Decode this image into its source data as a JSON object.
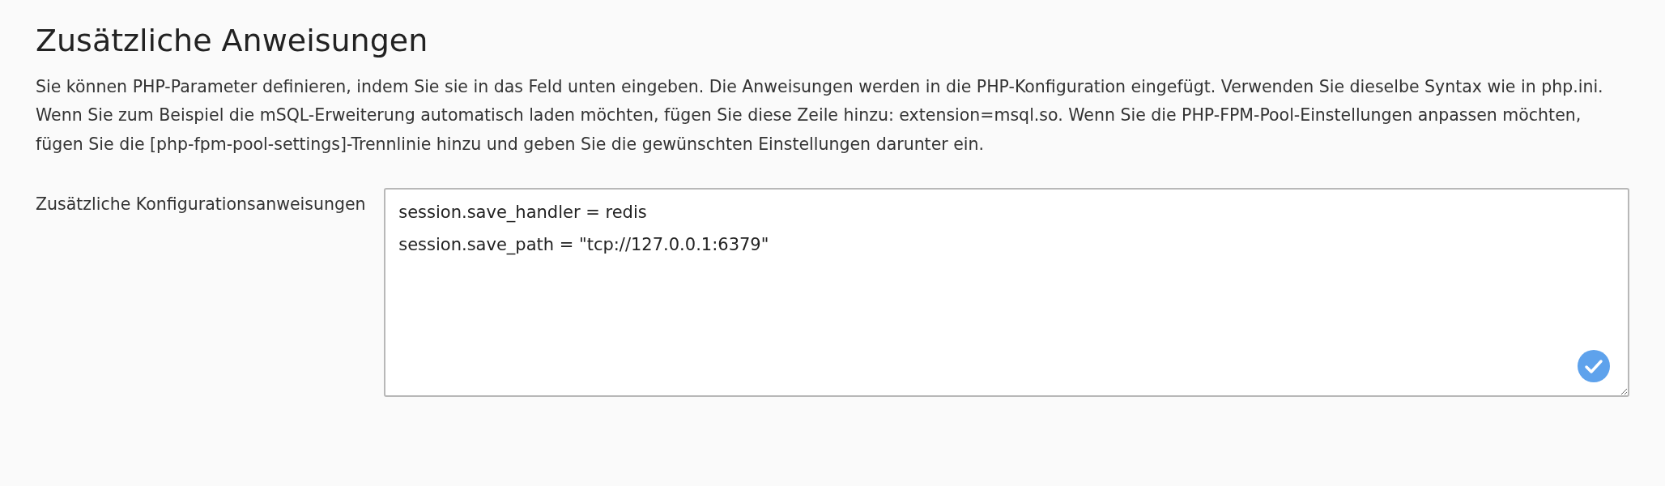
{
  "heading": "Zusätzliche Anweisungen",
  "description": "Sie können PHP-Parameter definieren, indem Sie sie in das Feld unten eingeben. Die Anweisungen werden in die PHP-Konfiguration eingefügt. Verwenden Sie dieselbe Syntax wie in php.ini. Wenn Sie zum Beispiel die mSQL-Erweiterung automatisch laden möchten, fügen Sie diese Zeile hinzu: extension=msql.so. Wenn Sie die PHP-FPM-Pool-Einstellungen anpassen möchten, fügen Sie die [php-fpm-pool-settings]-Trennlinie hinzu und geben Sie die gewünschten Einstellungen darunter ein.",
  "field": {
    "label": "Zusätzliche Konfigurationsanweisungen",
    "value": "session.save_handler = redis\nsession.save_path = \"tcp://127.0.0.1:6379\"",
    "valid": true
  }
}
